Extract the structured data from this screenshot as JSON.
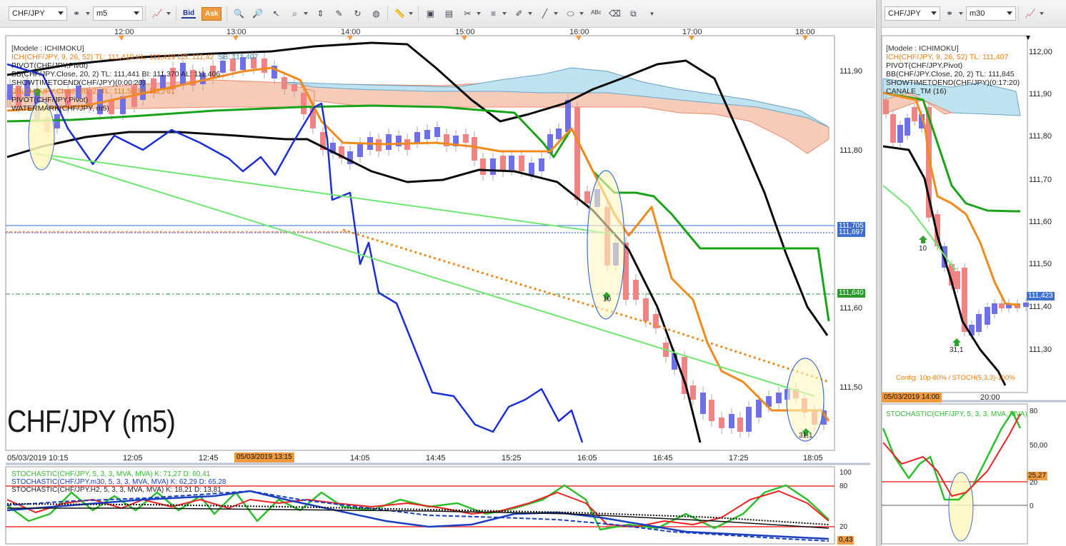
{
  "main": {
    "toolbar": {
      "symbol": "CHF/JPY",
      "timeframe": "m5",
      "bid_label": "Bid",
      "ask_label": "Ask"
    },
    "time_labels_top": [
      "12:00",
      "13:00",
      "14:00",
      "15:00",
      "16:00",
      "17:00",
      "18:00"
    ],
    "legend": [
      {
        "text": "[Modele : ICHIMOKU]",
        "color": "#333333"
      },
      {
        "text": "ICH(CHF/JPY, 9, 26, 52)  TL: 111,419   KL: 111,419   CS: 111,42",
        "color": "#e77a16"
      },
      {
        "text": "PIVOT(CHF/JPY,Pivot)",
        "color": "#222222"
      },
      {
        "text": "BB(CHF/JPY.Close, 20, 2)  TL: 111,441   BI: 111,370   AL: 111,406",
        "color": "#222222"
      },
      {
        "text": "SHOWTIMETOEND(CHF/JPY)(0:00:20)",
        "color": "#222222"
      },
      {
        "text": "BB(CHF/JPY.Close, 20, 2)  TL: 111,55   BI: 111,781",
        "color": "#e77a16"
      },
      {
        "text": "PIVOT(CHF/JPY,Pivot)",
        "color": "#222222"
      },
      {
        "text": "WATERMARK(CHF/JPY, m5)",
        "color": "#222222"
      }
    ],
    "legend_ich_extra": "SB: 111,407",
    "price_ticks": [
      "111,90",
      "111,80",
      "111,60",
      "111,50"
    ],
    "price_tags": [
      {
        "text": "111,705",
        "color": "#3d6fd1"
      },
      {
        "text": "111,697",
        "color": "#3d6fd1"
      },
      {
        "text": "111,640",
        "color": "#2b9a2b"
      }
    ],
    "watermark": "CHF/JPY (m5)",
    "x_labels": [
      "05/03/2019 10:15",
      "12:05",
      "12:45",
      "14:05",
      "14:45",
      "15:25",
      "16:05",
      "16:45",
      "17:25",
      "18:05"
    ],
    "date_tag": "05/03/2019 13:15",
    "annotations": [
      "10",
      "31,1"
    ],
    "stoch_legend": [
      {
        "text": "STOCHASTIC(CHF/JPY, 5, 3, 3, MVA, MVA)  K: 71,27   D: 60,41",
        "color": "#2bbf2b"
      },
      {
        "text": "STOCHASTIC(CHF/JPY.m30, 5, 3, 3, MVA, MVA)  K: 62,29   D: 65,28",
        "color": "#1a3fbf"
      },
      {
        "text": "STOCHASTIC(CHF/JPY.H2, 5, 3, 3, MVA, MVA)  K: 18,21   D: 13,81",
        "color": "#222222"
      }
    ],
    "stoch_ticks": [
      "100",
      "80",
      "20",
      "0,43"
    ]
  },
  "side": {
    "toolbar": {
      "symbol": "CHF/JPY",
      "timeframe": "m30"
    },
    "legend": [
      {
        "text": "[Modele : ICHIMOKU]",
        "color": "#333333"
      },
      {
        "text": "ICH(CHF/JPY, 9, 26, 52)  TL: 111,407",
        "color": "#e77a16"
      },
      {
        "text": "PIVOT(CHF/JPY,Pivot)",
        "color": "#222222"
      },
      {
        "text": "BB(CHF/JPY.Close, 20, 2)  TL: 111,845",
        "color": "#222222"
      },
      {
        "text": "SHOWTIMETOEND(CHF/JPY)(0:17:20)",
        "color": "#222222"
      },
      {
        "text": "CANALE_TM (16)",
        "color": "#222222"
      }
    ],
    "price_ticks": [
      "112,00",
      "111,90",
      "111,80",
      "111,70",
      "111,60",
      "111,50",
      "111,40",
      "111,30"
    ],
    "price_tag": "111,423",
    "annotations": [
      "10",
      "31,1"
    ],
    "config": "Config: 10p-80% / STOCH(5,3,3)-100%",
    "date_tag": "05/03/2019 14:00",
    "x_label": "20:00",
    "stoch_legend": "STOCHASTIC(CHF/JPY, 5, 3, 3, MVA, MVA)",
    "stoch_ticks": [
      "80",
      "50,00",
      "25,27",
      "20",
      "0"
    ]
  },
  "colors": {
    "accent": "#f19a3e",
    "bull": "#6f6fe8",
    "bear": "#f07d7d",
    "green": "#19a319",
    "orange": "#f08a1c",
    "blue": "#1a2fd6"
  }
}
